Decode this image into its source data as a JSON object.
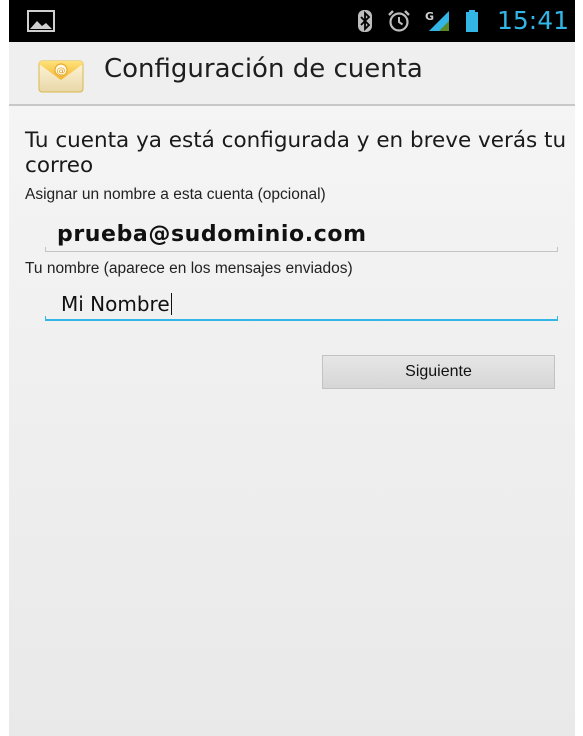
{
  "status_bar": {
    "time": "15:41",
    "accent_color": "#33b5e5",
    "icons": [
      "picture-icon",
      "bluetooth-icon",
      "alarm-icon",
      "signal-icon",
      "battery-icon"
    ]
  },
  "action_bar": {
    "title": "Configuración de cuenta",
    "icon": "email-app-icon"
  },
  "content": {
    "heading": "Tu cuenta ya está configurada y en breve verás tu correo",
    "account_name_label": "Asignar un nombre a esta cuenta (opcional)",
    "account_name_value": "prueba@sudominio.com",
    "your_name_label": "Tu nombre (aparece en los mensajes enviados)",
    "your_name_value": "Mi Nombre",
    "next_button": "Siguiente"
  }
}
